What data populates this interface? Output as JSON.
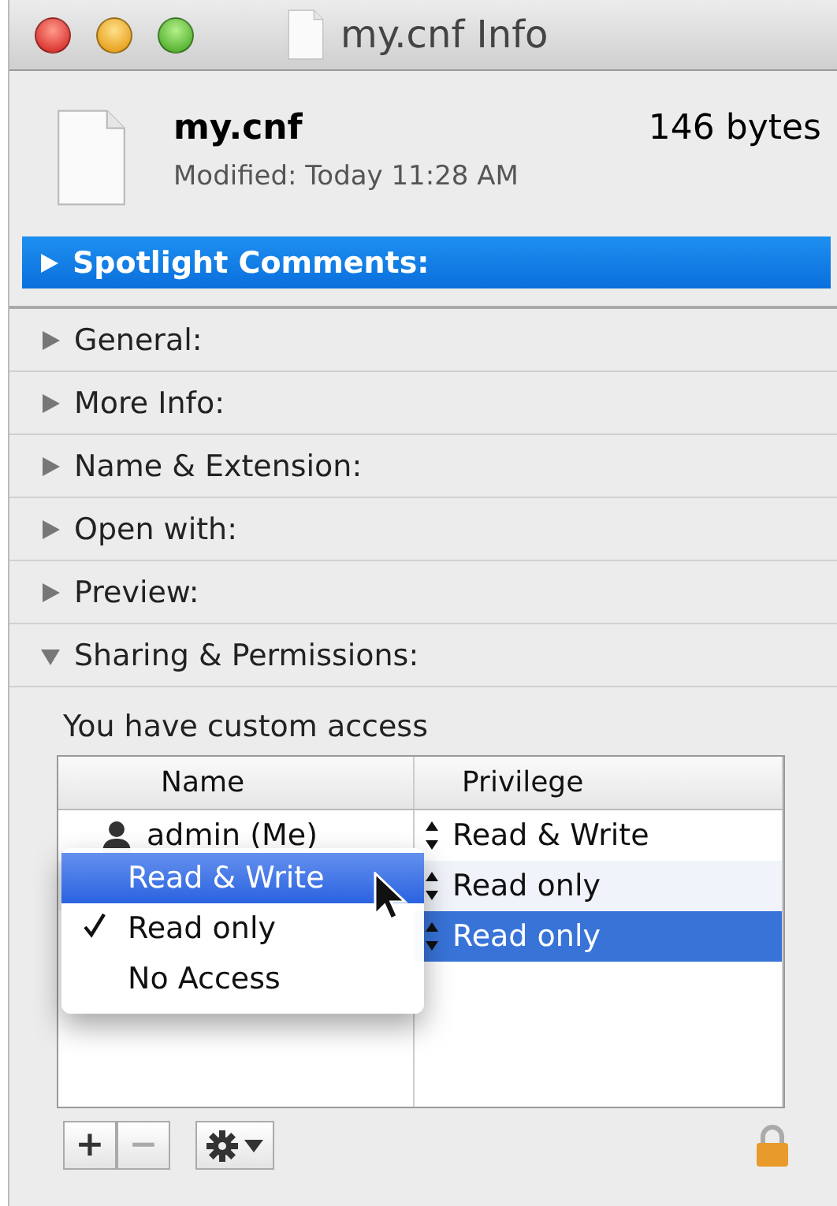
{
  "window": {
    "title": "my.cnf Info"
  },
  "file": {
    "name": "my.cnf",
    "size": "146 bytes",
    "modified": "Modified: Today 11:28 AM"
  },
  "sections": [
    {
      "label": "Spotlight Comments:",
      "expanded": false,
      "selected": true
    },
    {
      "label": "General:",
      "expanded": false,
      "selected": false
    },
    {
      "label": "More Info:",
      "expanded": false,
      "selected": false
    },
    {
      "label": "Name & Extension:",
      "expanded": false,
      "selected": false
    },
    {
      "label": "Open with:",
      "expanded": false,
      "selected": false
    },
    {
      "label": "Preview:",
      "expanded": false,
      "selected": false
    },
    {
      "label": "Sharing & Permissions:",
      "expanded": true,
      "selected": false
    }
  ],
  "access_note": "You have custom access",
  "table": {
    "columns": [
      "Name",
      "Privilege"
    ],
    "rows": [
      {
        "name": "admin (Me)",
        "privilege": "Read & Write",
        "selected": false
      },
      {
        "privilege": "Read only",
        "selected": false
      },
      {
        "privilege": "Read only",
        "selected": true
      }
    ]
  },
  "privilege_menu": [
    {
      "label": "Read & Write",
      "checked": false,
      "selected": true
    },
    {
      "label": "Read only",
      "checked": true,
      "selected": false
    },
    {
      "label": "No Access",
      "checked": false,
      "selected": false
    }
  ],
  "toolbar": {
    "add": "+",
    "remove": "−"
  }
}
